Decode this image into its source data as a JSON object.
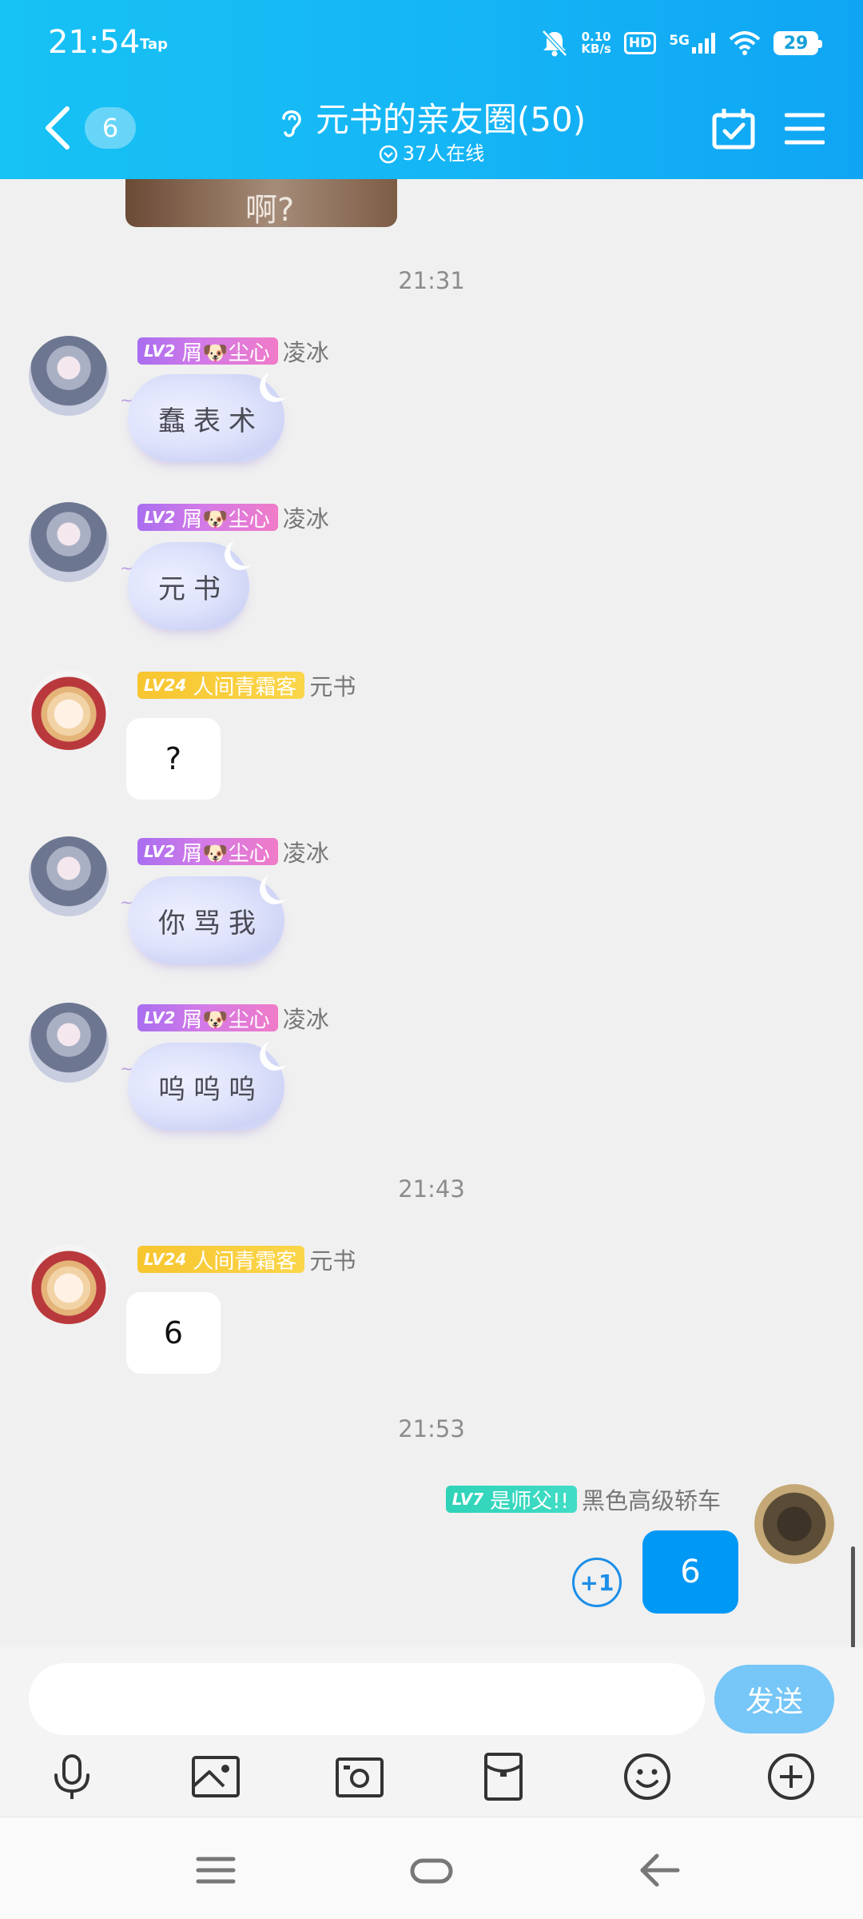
{
  "status_bar": {
    "time": "21:54",
    "tap_label": "Tap",
    "net_speed_value": "0.10",
    "net_speed_unit": "KB/s",
    "hd_label": "HD",
    "network": "5G",
    "battery": "29"
  },
  "header": {
    "unread_count": "6",
    "title": "元书的亲友圈(50)",
    "online": "37人在线",
    "colors": {
      "gradient_start": "#17c2f4",
      "gradient_end": "#0fa5f4"
    }
  },
  "top_image": {
    "caption": "啊?"
  },
  "timestamps": [
    "21:31",
    "21:43",
    "21:53"
  ],
  "messages": [
    {
      "sender": "凌冰",
      "badge_lv": "LV2",
      "badge_title": "屑🐶尘心",
      "text": "蠢表术",
      "style": "cloud"
    },
    {
      "sender": "凌冰",
      "badge_lv": "LV2",
      "badge_title": "屑🐶尘心",
      "text": "元书",
      "style": "cloud"
    },
    {
      "sender": "元书",
      "badge_lv": "LV24",
      "badge_title": "人间青霜客",
      "text": "?",
      "style": "plain"
    },
    {
      "sender": "凌冰",
      "badge_lv": "LV2",
      "badge_title": "屑🐶尘心",
      "text": "你骂我",
      "style": "cloud"
    },
    {
      "sender": "凌冰",
      "badge_lv": "LV2",
      "badge_title": "屑🐶尘心",
      "text": "呜呜呜",
      "style": "cloud"
    },
    {
      "sender": "元书",
      "badge_lv": "LV24",
      "badge_title": "人间青霜客",
      "text": "6",
      "style": "plain"
    },
    {
      "sender": "黑色高级轿车",
      "badge_lv": "LV7",
      "badge_title": "是师父!!",
      "text": "6",
      "style": "self",
      "plus_one": "+1"
    }
  ],
  "input": {
    "placeholder": "",
    "send_label": "发送"
  },
  "toolbar": [
    "microphone-icon",
    "image-icon",
    "camera-icon",
    "red-packet-icon",
    "emoji-icon",
    "plus-icon"
  ],
  "nav": [
    "menu-icon",
    "home-icon",
    "back-icon"
  ]
}
